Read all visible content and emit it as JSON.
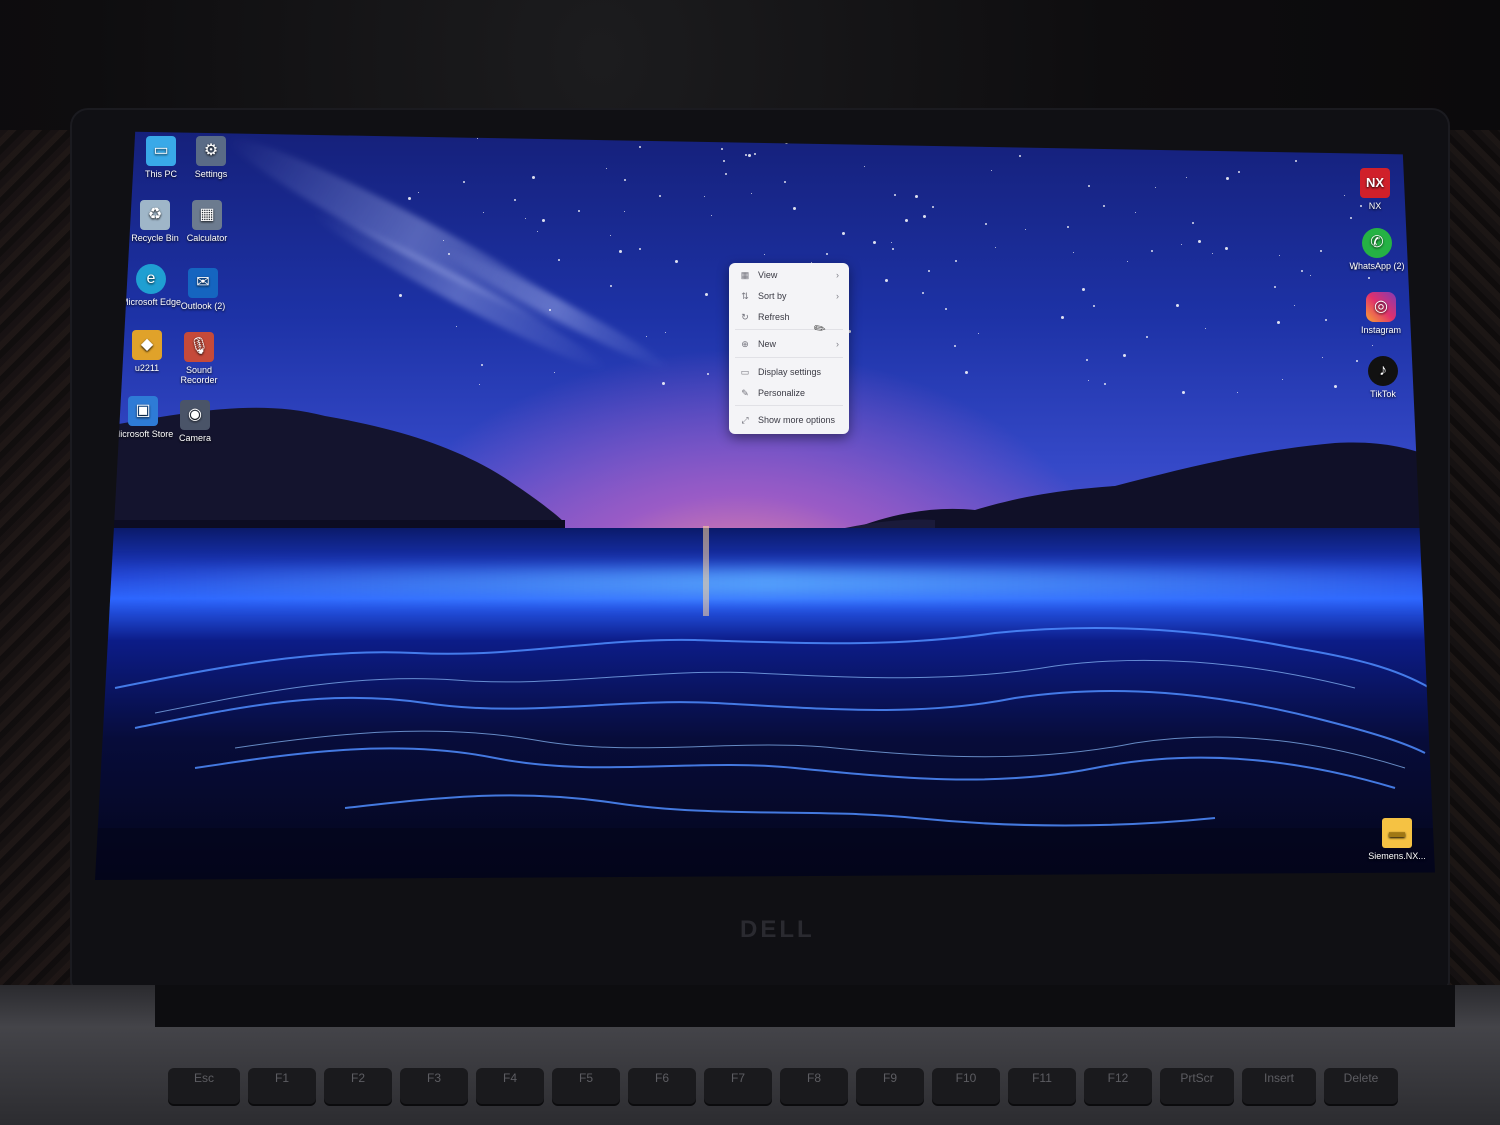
{
  "desktop": {
    "left_icons": [
      {
        "name": "this-pc",
        "label": "This PC",
        "icon": "monitor-icon"
      },
      {
        "name": "settings",
        "label": "Settings",
        "icon": "gear-icon"
      },
      {
        "name": "recycle-bin",
        "label": "Recycle Bin",
        "icon": "recycle-bin-icon"
      },
      {
        "name": "calculator",
        "label": "Calculator",
        "icon": "calculator-icon"
      },
      {
        "name": "microsoft-edge",
        "label": "Microsoft Edge",
        "icon": "edge-icon"
      },
      {
        "name": "outlook",
        "label": "Outlook (2)",
        "icon": "outlook-icon"
      },
      {
        "name": "u2211",
        "label": "u2211",
        "icon": "app-icon"
      },
      {
        "name": "sound-recorder",
        "label": "Sound Recorder",
        "icon": "microphone-icon"
      },
      {
        "name": "microsoft-store",
        "label": "Microsoft Store",
        "icon": "store-icon"
      },
      {
        "name": "camera",
        "label": "Camera",
        "icon": "camera-icon"
      }
    ],
    "right_icons": [
      {
        "name": "nx",
        "label": "NX",
        "badge": "NX",
        "icon": "nx-icon"
      },
      {
        "name": "whatsapp",
        "label": "WhatsApp (2)",
        "icon": "whatsapp-icon"
      },
      {
        "name": "instagram",
        "label": "Instagram",
        "icon": "instagram-icon"
      },
      {
        "name": "tiktok",
        "label": "TikTok",
        "icon": "tiktok-icon"
      }
    ],
    "folder": {
      "label": "Siemens.NX...",
      "icon": "folder-icon"
    }
  },
  "context_menu": {
    "items": [
      {
        "label": "View",
        "icon": "grid-icon",
        "submenu": true
      },
      {
        "label": "Sort by",
        "icon": "sort-icon",
        "submenu": true
      },
      {
        "label": "Refresh",
        "icon": "refresh-icon",
        "submenu": false
      },
      {
        "label": "New",
        "icon": "plus-circle-icon",
        "submenu": true
      },
      {
        "label": "Display settings",
        "icon": "display-icon",
        "submenu": false
      },
      {
        "label": "Personalize",
        "icon": "pen-icon",
        "submenu": false
      },
      {
        "label": "Show more options",
        "icon": "expand-icon",
        "submenu": false
      }
    ]
  },
  "laptop": {
    "brand": "DELL",
    "keys": [
      "Esc",
      "F1",
      "F2",
      "F3",
      "F4",
      "F5",
      "F6",
      "F7",
      "F8",
      "F9",
      "F10",
      "F11",
      "F12",
      "PrtScr",
      "Insert",
      "Delete"
    ]
  },
  "colors": {
    "menu_bg": "#f4f4f7",
    "sky_top": "#15207a",
    "sea_glow": "#2b63ff",
    "nx_red": "#d0202a",
    "folder_yellow": "#f5c243"
  }
}
